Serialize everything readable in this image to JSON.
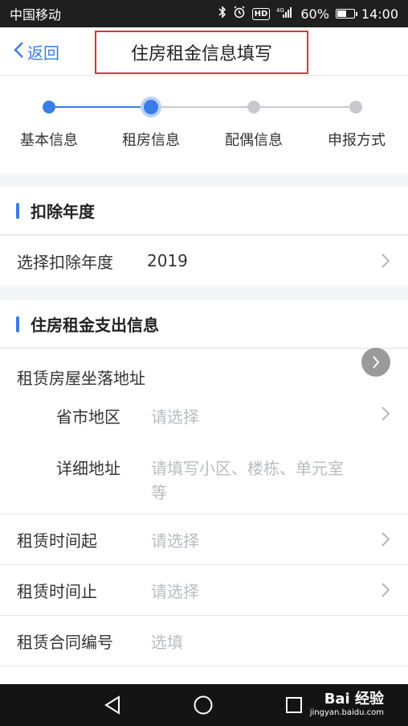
{
  "status_bar": {
    "carrier": "中国移动",
    "network": "4G",
    "battery": "60%",
    "battery_level": 0.6,
    "time": "14:00"
  },
  "nav": {
    "back_label": "返回",
    "title": "住房租金信息填写"
  },
  "steps": [
    {
      "label": "基本信息",
      "state": "done"
    },
    {
      "label": "租房信息",
      "state": "current"
    },
    {
      "label": "配偶信息",
      "state": "todo"
    },
    {
      "label": "申报方式",
      "state": "todo"
    }
  ],
  "deduction_year": {
    "section_title": "扣除年度",
    "row_label": "选择扣除年度",
    "row_value": "2019"
  },
  "rent_info": {
    "section_title": "住房租金支出信息",
    "address_label": "租赁房屋坐落地址",
    "region_label": "省市地区",
    "region_placeholder": "请选择",
    "detail_label": "详细地址",
    "detail_placeholder_line1": "请填写小区、楼栋、单元室",
    "detail_placeholder_line2": "等",
    "start_label": "租赁时间起",
    "start_placeholder": "请选择",
    "end_label": "租赁时间止",
    "end_placeholder": "请选择",
    "contract_label": "租赁合同编号",
    "contract_placeholder": "选填"
  },
  "watermark": {
    "brand": "Bai 经验",
    "url": "jingyan.baidu.com"
  },
  "colors": {
    "accent": "#3a7ce8",
    "highlight_border": "#d9343a",
    "placeholder": "#b9bcc2",
    "inactive": "#c7c9cf"
  }
}
